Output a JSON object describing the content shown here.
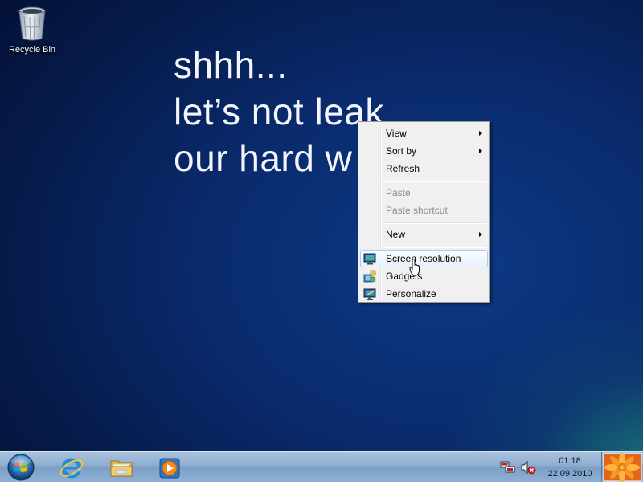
{
  "desktop": {
    "icons": [
      {
        "label": "Recycle Bin",
        "icon": "recycle-bin-icon"
      }
    ],
    "message_lines": [
      "shhh...",
      "let’s not leak",
      "our hard w"
    ],
    "colors": {
      "background": "#0a2a6c",
      "accent_glow": "#28b48c"
    }
  },
  "context_menu": {
    "items": [
      {
        "label": "View",
        "submenu": true,
        "disabled": false
      },
      {
        "label": "Sort by",
        "submenu": true,
        "disabled": false
      },
      {
        "label": "Refresh",
        "submenu": false,
        "disabled": false
      },
      {
        "label": "Paste",
        "submenu": false,
        "disabled": true
      },
      {
        "label": "Paste shortcut",
        "submenu": false,
        "disabled": true
      },
      {
        "label": "New",
        "submenu": true,
        "disabled": false
      },
      {
        "label": "Screen resolution",
        "submenu": false,
        "disabled": false,
        "icon": "monitor-icon",
        "highlighted": true
      },
      {
        "label": "Gadgets",
        "submenu": false,
        "disabled": false,
        "icon": "gadgets-icon"
      },
      {
        "label": "Personalize",
        "submenu": false,
        "disabled": false,
        "icon": "personalize-icon"
      }
    ]
  },
  "taskbar": {
    "start_icon": "windows-orb-icon",
    "pinned": [
      {
        "name": "Internet Explorer",
        "icon": "internet-explorer-icon"
      },
      {
        "name": "Windows Explorer",
        "icon": "folder-icon"
      },
      {
        "name": "Windows Media Player",
        "icon": "media-player-icon"
      }
    ],
    "tray": {
      "network_icon": "network-icon",
      "volume_icon": "volume-muted-icon",
      "time": "01:18",
      "date": "22.09.2010"
    }
  }
}
